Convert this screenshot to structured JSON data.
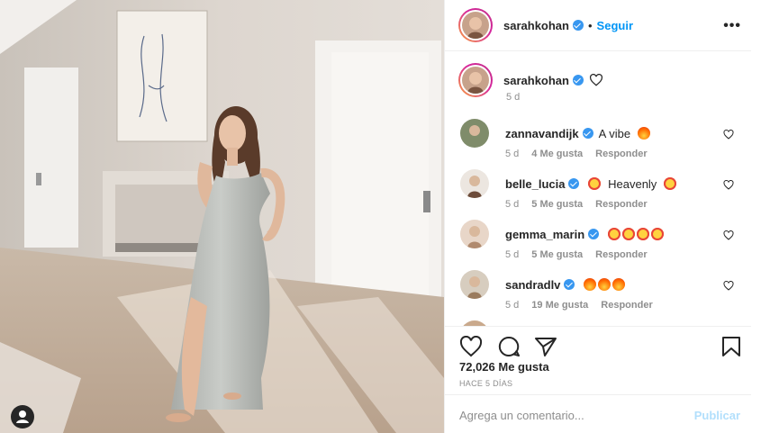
{
  "post": {
    "author": "sarahkohan",
    "follow_label": "Seguir",
    "separator": "•",
    "more_label": "•••",
    "caption_time": "5 d",
    "likes": "72,026 Me gusta",
    "posted_ago": "HACE 5 DÍAS"
  },
  "comments": [
    {
      "user": "zannavandijk",
      "text": "A vibe",
      "emojis": [
        "fire"
      ],
      "time": "5 d",
      "likes": "4 Me gusta",
      "reply": "Responder"
    },
    {
      "user": "belle_lucia",
      "text": "Heavenly",
      "emojis_before": [
        "star-struck"
      ],
      "emojis": [
        "star-struck"
      ],
      "time": "5 d",
      "likes": "5 Me gusta",
      "reply": "Responder"
    },
    {
      "user": "gemma_marin",
      "text": "",
      "emojis": [
        "star-struck",
        "star-struck",
        "star-struck",
        "star-struck"
      ],
      "time": "5 d",
      "likes": "5 Me gusta",
      "reply": "Responder"
    },
    {
      "user": "sandradlv",
      "text": "",
      "emojis": [
        "fire",
        "fire",
        "fire"
      ],
      "time": "5 d",
      "likes": "19 Me gusta",
      "reply": "Responder"
    }
  ],
  "composer": {
    "placeholder": "Agrega un comentario...",
    "publish_label": "Publicar"
  },
  "icons": {
    "actions": [
      "heart-icon",
      "comment-icon",
      "share-icon",
      "bookmark-icon"
    ],
    "verified": "verified-badge-icon"
  },
  "colors": {
    "accent": "#0095f6",
    "verified": "#3897f0",
    "muted": "#8e8e8e",
    "publish_disabled": "#b2dffc"
  }
}
